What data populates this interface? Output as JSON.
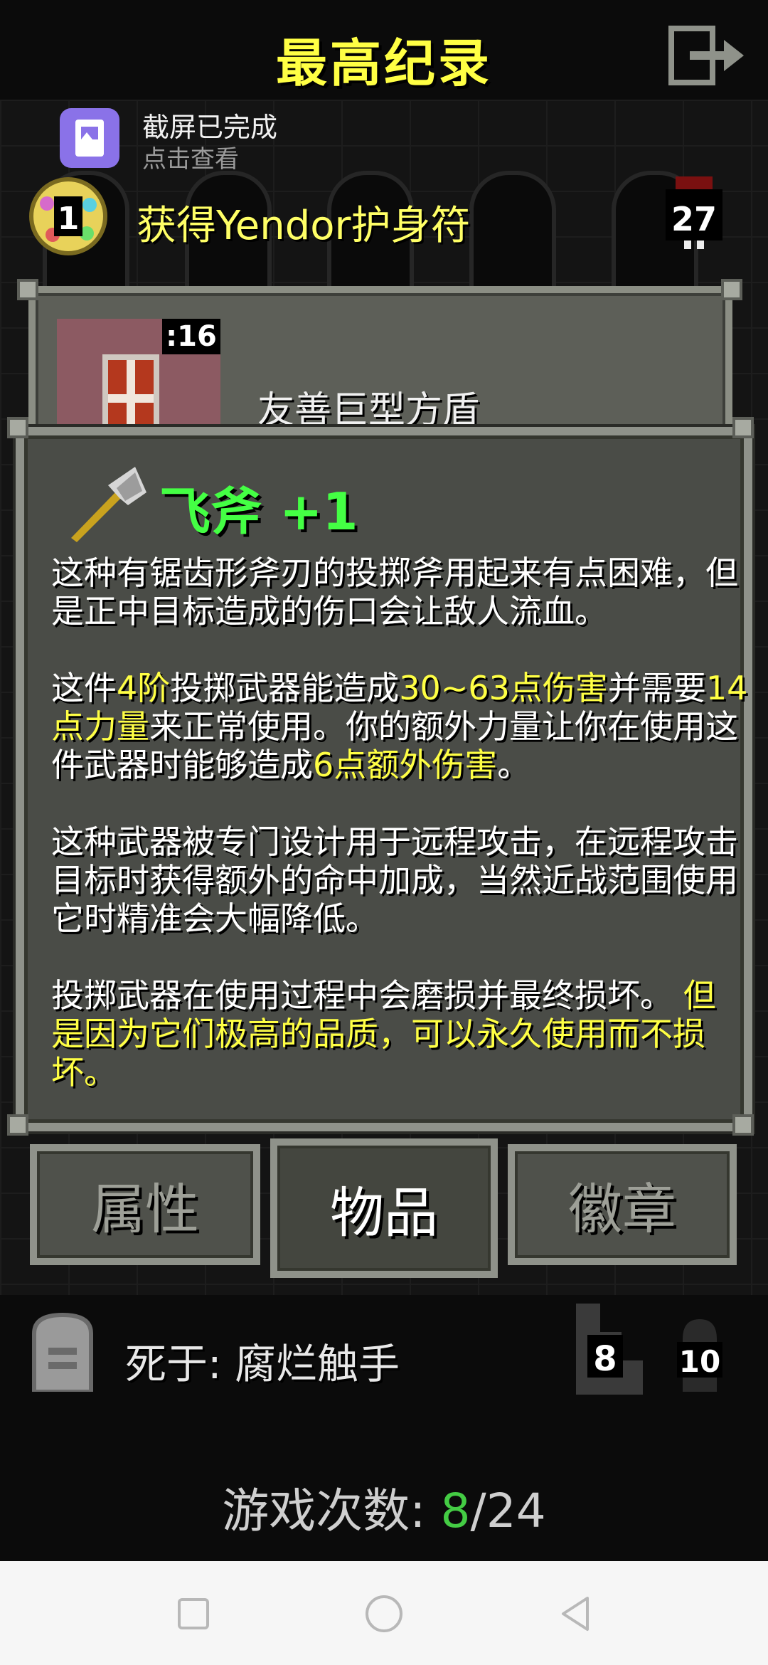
{
  "header": {
    "title": "最高纪录",
    "exit_icon": "exit-icon"
  },
  "notification": {
    "title": "截屏已完成",
    "subtitle": "点击查看",
    "icon": "screenshot-icon"
  },
  "record": {
    "rank": "1",
    "text": "获得Yendor护身符",
    "skull_value": "27"
  },
  "back_item": {
    "quantity": ":16",
    "name": "友善巨型方盾"
  },
  "item": {
    "name": "飞斧 +1",
    "icon": "axe-icon",
    "p1": "这种有锯齿形斧刃的投掷斧用起来有点困难，但是正中目标造成的伤口会让敌人流血。",
    "p2_a": "这件",
    "p2_b": "4阶",
    "p2_c": "投掷武器能造成",
    "p2_d": "30~63点伤害",
    "p2_e": "并需要",
    "p2_f": "14点力量",
    "p2_g": "来正常使用。你的额外力量让你在使用这件武器时能够造成",
    "p2_h": "6点额外伤害",
    "p2_i": "。",
    "p3": "这种武器被专门设计用于远程攻击，在远程攻击目标时获得额外的命中加成，当然近战范围使用它时精准会大幅降低。",
    "p4_a": "投掷武器在使用过程中会磨损并最终损坏。",
    "p4_b": "但是因为它们极高的品质，可以永久使用而不损坏。"
  },
  "tabs": [
    {
      "label": "属性",
      "active": false
    },
    {
      "label": "物品",
      "active": true
    },
    {
      "label": "徽章",
      "active": false
    }
  ],
  "death": {
    "text": "死于:  腐烂触手",
    "depth": "8",
    "level": "10"
  },
  "games": {
    "label": "游戏次数: ",
    "current": "8",
    "sep": "/",
    "total": "24"
  },
  "colors": {
    "yellow": "#ffff44",
    "green": "#44ff44",
    "panel": "#4a4c47",
    "border": "#8f928a"
  }
}
